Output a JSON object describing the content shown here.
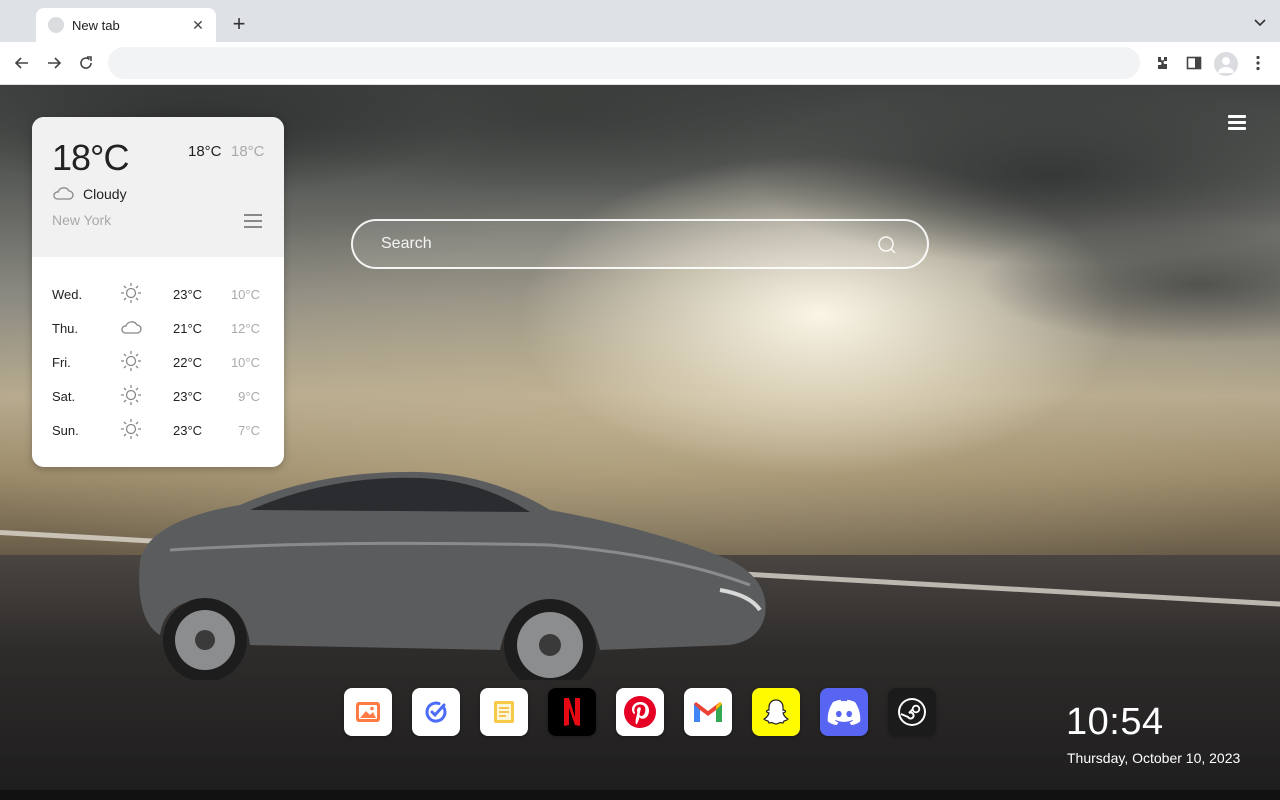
{
  "browser": {
    "tab_title": "New tab",
    "tab_close": "✕",
    "new_tab": "+",
    "address": ""
  },
  "search": {
    "placeholder": "Search"
  },
  "weather": {
    "current_temp": "18°C",
    "high": "18°C",
    "low": "18°C",
    "condition": "Cloudy",
    "city": "New York",
    "forecast": [
      {
        "day": "Wed.",
        "icon": "sun-icon",
        "max": "23°C",
        "min": "10°C"
      },
      {
        "day": "Thu.",
        "icon": "cloud-icon",
        "max": "21°C",
        "min": "12°C"
      },
      {
        "day": "Fri.",
        "icon": "sun-icon",
        "max": "22°C",
        "min": "10°C"
      },
      {
        "day": "Sat.",
        "icon": "sun-icon",
        "max": "23°C",
        "min": "9°C"
      },
      {
        "day": "Sun.",
        "icon": "sun-icon",
        "max": "23°C",
        "min": "7°C"
      }
    ]
  },
  "dock": [
    {
      "name": "gallery-icon",
      "bg": "#ffffff"
    },
    {
      "name": "checkmark-app-icon",
      "bg": "#ffffff"
    },
    {
      "name": "notes-icon",
      "bg": "#ffffff"
    },
    {
      "name": "netflix-icon",
      "bg": "#000000"
    },
    {
      "name": "pinterest-icon",
      "bg": "#ffffff"
    },
    {
      "name": "gmail-icon",
      "bg": "#ffffff"
    },
    {
      "name": "snapchat-icon",
      "bg": "#fffc00"
    },
    {
      "name": "discord-icon",
      "bg": "#5865f2"
    },
    {
      "name": "steam-icon",
      "bg": "#1b1b1b"
    }
  ],
  "clock": {
    "time": "10:54",
    "date": "Thursday, October 10, 2023"
  },
  "colors": {
    "accent_white": "#ffffff",
    "chrome_bg": "#dee1e6"
  }
}
